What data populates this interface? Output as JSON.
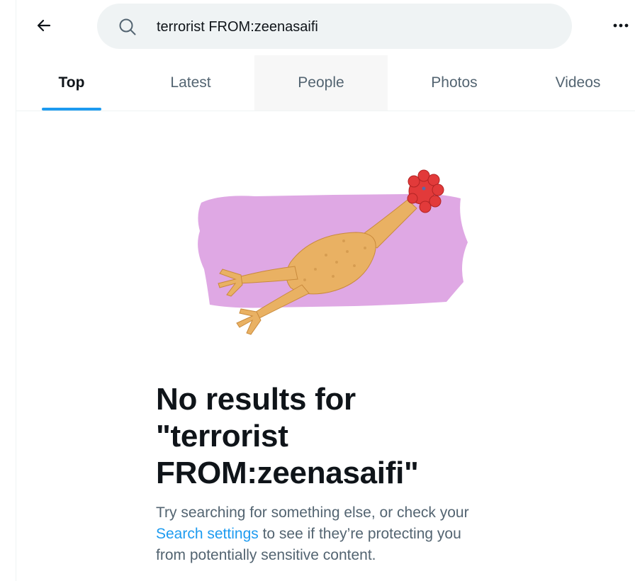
{
  "header": {
    "back_icon": "arrow-left-icon",
    "search": {
      "icon": "search-icon",
      "value": "terrorist FROM:zeenasaifi",
      "placeholder": "Search Twitter"
    },
    "more_icon": "more-horizontal-icon"
  },
  "tabs": [
    {
      "label": "Top",
      "active": true
    },
    {
      "label": "Latest",
      "active": false
    },
    {
      "label": "People",
      "active": false
    },
    {
      "label": "Photos",
      "active": false
    },
    {
      "label": "Videos",
      "active": false
    }
  ],
  "empty_state": {
    "illustration": "rubber-chicken-illustration",
    "title_line1": "No results for",
    "title_line2": "\"terrorist",
    "title_line3": "FROM:zeenasaifi\"",
    "desc_line1": "Try searching for something else, or check your",
    "desc_link": "Search settings",
    "desc_line2_rest": " to see if they’re protecting you",
    "desc_line3": "from potentially sensitive content."
  },
  "colors": {
    "accent": "#1d9bf0",
    "text_primary": "#0f1419",
    "text_secondary": "#536471",
    "search_bg": "#eff3f4",
    "illustration_bg": "#dfa8e4"
  }
}
